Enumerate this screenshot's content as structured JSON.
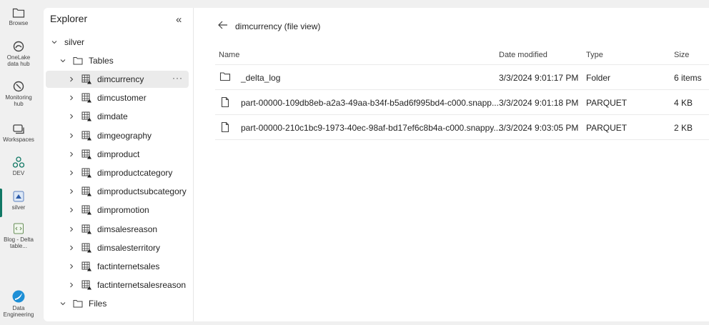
{
  "rail": [
    {
      "label": "Browse",
      "icon": "folder-icon"
    },
    {
      "label": "OneLake data hub",
      "icon": "onelake-icon"
    },
    {
      "label": "Monitoring hub",
      "icon": "monitoring-icon"
    },
    {
      "label": "Workspaces",
      "icon": "workspaces-icon"
    },
    {
      "label": "DEV",
      "icon": "workspace-dev-icon"
    },
    {
      "label": "silver",
      "icon": "lakehouse-icon"
    },
    {
      "label": "Blog - Delta table...",
      "icon": "notebook-icon"
    },
    {
      "label": "Data Engineering",
      "icon": "data-engineering-icon"
    }
  ],
  "explorer": {
    "title": "Explorer",
    "lakehouse": "silver",
    "tables_label": "Tables",
    "tables": [
      "dimcurrency",
      "dimcustomer",
      "dimdate",
      "dimgeography",
      "dimproduct",
      "dimproductcategory",
      "dimproductsubcategory",
      "dimpromotion",
      "dimsalesreason",
      "dimsalesterritory",
      "factinternetsales",
      "factinternetsalesreason"
    ],
    "files_label": "Files",
    "more": "···"
  },
  "main": {
    "breadcrumb": "dimcurrency (file view)",
    "columns": {
      "name": "Name",
      "date": "Date modified",
      "type": "Type",
      "size": "Size"
    },
    "rows": [
      {
        "name": "_delta_log",
        "date": "3/3/2024 9:01:17 PM",
        "type": "Folder",
        "size": "6 items",
        "icon": "folder-icon"
      },
      {
        "name": "part-00000-109db8eb-a2a3-49aa-b34f-b5ad6f995bd4-c000.snapp...",
        "date": "3/3/2024 9:01:18 PM",
        "type": "PARQUET",
        "size": "4 KB",
        "icon": "file-icon"
      },
      {
        "name": "part-00000-210c1bc9-1973-40ec-98af-bd17ef6c8b4a-c000.snappy...",
        "date": "3/3/2024 9:03:05 PM",
        "type": "PARQUET",
        "size": "2 KB",
        "icon": "file-icon"
      }
    ]
  }
}
